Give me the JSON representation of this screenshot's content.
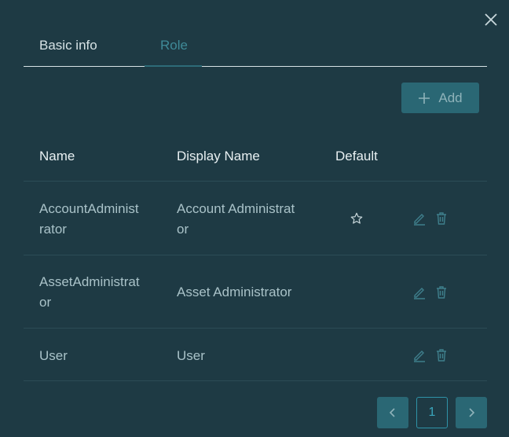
{
  "tabs": [
    {
      "label": "Basic info"
    },
    {
      "label": "Role"
    }
  ],
  "add_button": {
    "label": "Add"
  },
  "table": {
    "headers": [
      "Name",
      "Display Name",
      "Default"
    ],
    "rows": [
      {
        "name_line1": "AccountAdminist",
        "name_line2": "rator",
        "display_line1": "Account Administrat",
        "display_line2": "or",
        "default": true
      },
      {
        "name_line1": "AssetAdministrat",
        "name_line2": "or",
        "display_line1": "Asset Administrator",
        "display_line2": "",
        "default": false
      },
      {
        "name_line1": "User",
        "name_line2": "",
        "display_line1": "User",
        "display_line2": "",
        "default": false
      }
    ]
  },
  "pagination": {
    "current": "1"
  },
  "colors": {
    "background": "#1e3a44",
    "accent": "#2a6774",
    "active_tab": "#3f8a98"
  },
  "icons": [
    "close-icon",
    "plus-icon",
    "star-icon",
    "edit-icon",
    "delete-icon",
    "chevron-left-icon",
    "chevron-right-icon"
  ]
}
